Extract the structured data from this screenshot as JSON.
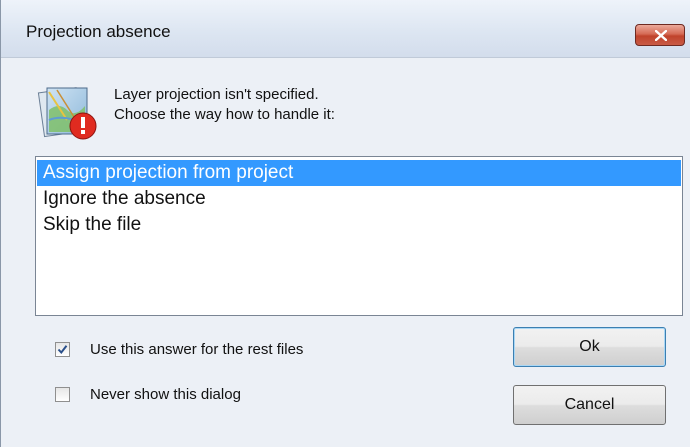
{
  "window": {
    "title": "Projection absence",
    "close_icon": "close-icon"
  },
  "message": {
    "line1": "Layer projection isn't specified.",
    "line2": "Choose the way how to handle it:",
    "icon": "layer-warning-icon",
    "warning_color": "#e02b20"
  },
  "options": {
    "items": [
      {
        "label": "Assign projection from project",
        "selected": true
      },
      {
        "label": "Ignore the absence",
        "selected": false
      },
      {
        "label": "Skip the file",
        "selected": false
      }
    ],
    "selection_color": "#3399ff"
  },
  "checkboxes": {
    "use_answer": {
      "label": "Use this answer for the rest files",
      "checked": true
    },
    "never_show": {
      "label": "Never show this dialog",
      "checked": false
    }
  },
  "buttons": {
    "ok_label": "Ok",
    "cancel_label": "Cancel"
  }
}
